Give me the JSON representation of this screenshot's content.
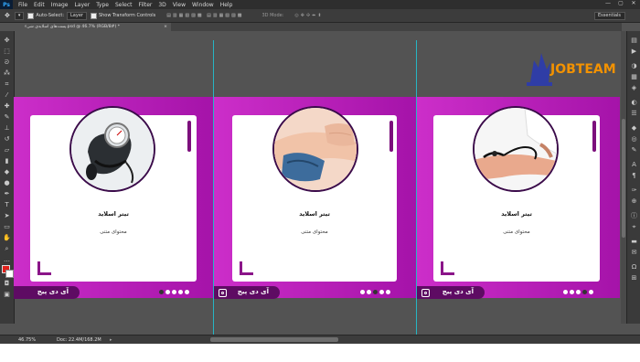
{
  "app": {
    "logo": "Ps",
    "menu": [
      "File",
      "Edit",
      "Image",
      "Layer",
      "Type",
      "Select",
      "Filter",
      "3D",
      "View",
      "Window",
      "Help"
    ],
    "window_controls": [
      "—",
      "▢",
      "✕"
    ]
  },
  "options": {
    "auto_select": "Auto-Select:",
    "layer_dropdown": "Layer",
    "transform": "Show Transform Controls",
    "mode3d": "3D Mode:",
    "workspace": "Essentials"
  },
  "document": {
    "tab_title": "پست‌های اسلایدی شیء.psd @ 46.7% (RGB/8#) *"
  },
  "cards": [
    {
      "title": "تیتر اسلاید",
      "subtitle": "محتوای متنی",
      "brand": "آی دی پیج",
      "image": "blood-pressure-cuff-icon"
    },
    {
      "title": "تیتر اسلاید",
      "subtitle": "محتوای متنی",
      "brand": "آی دی پیج",
      "image": "arm-cuff-icon"
    },
    {
      "title": "تیتر اسلاید",
      "subtitle": "محتوای متنی",
      "brand": "آی دی پیج",
      "image": "bp-measurement-icon"
    }
  ],
  "watermark": "JOBTEAM",
  "status": {
    "zoom": "46.75%",
    "doc": "Doc: 22.4M/168.2M"
  },
  "colors": {
    "panel": "#b51fb8",
    "accent": "#7c0f7c",
    "footer": "#5e0b63",
    "guide": "#26b5c3",
    "watermark": "#f39200"
  }
}
